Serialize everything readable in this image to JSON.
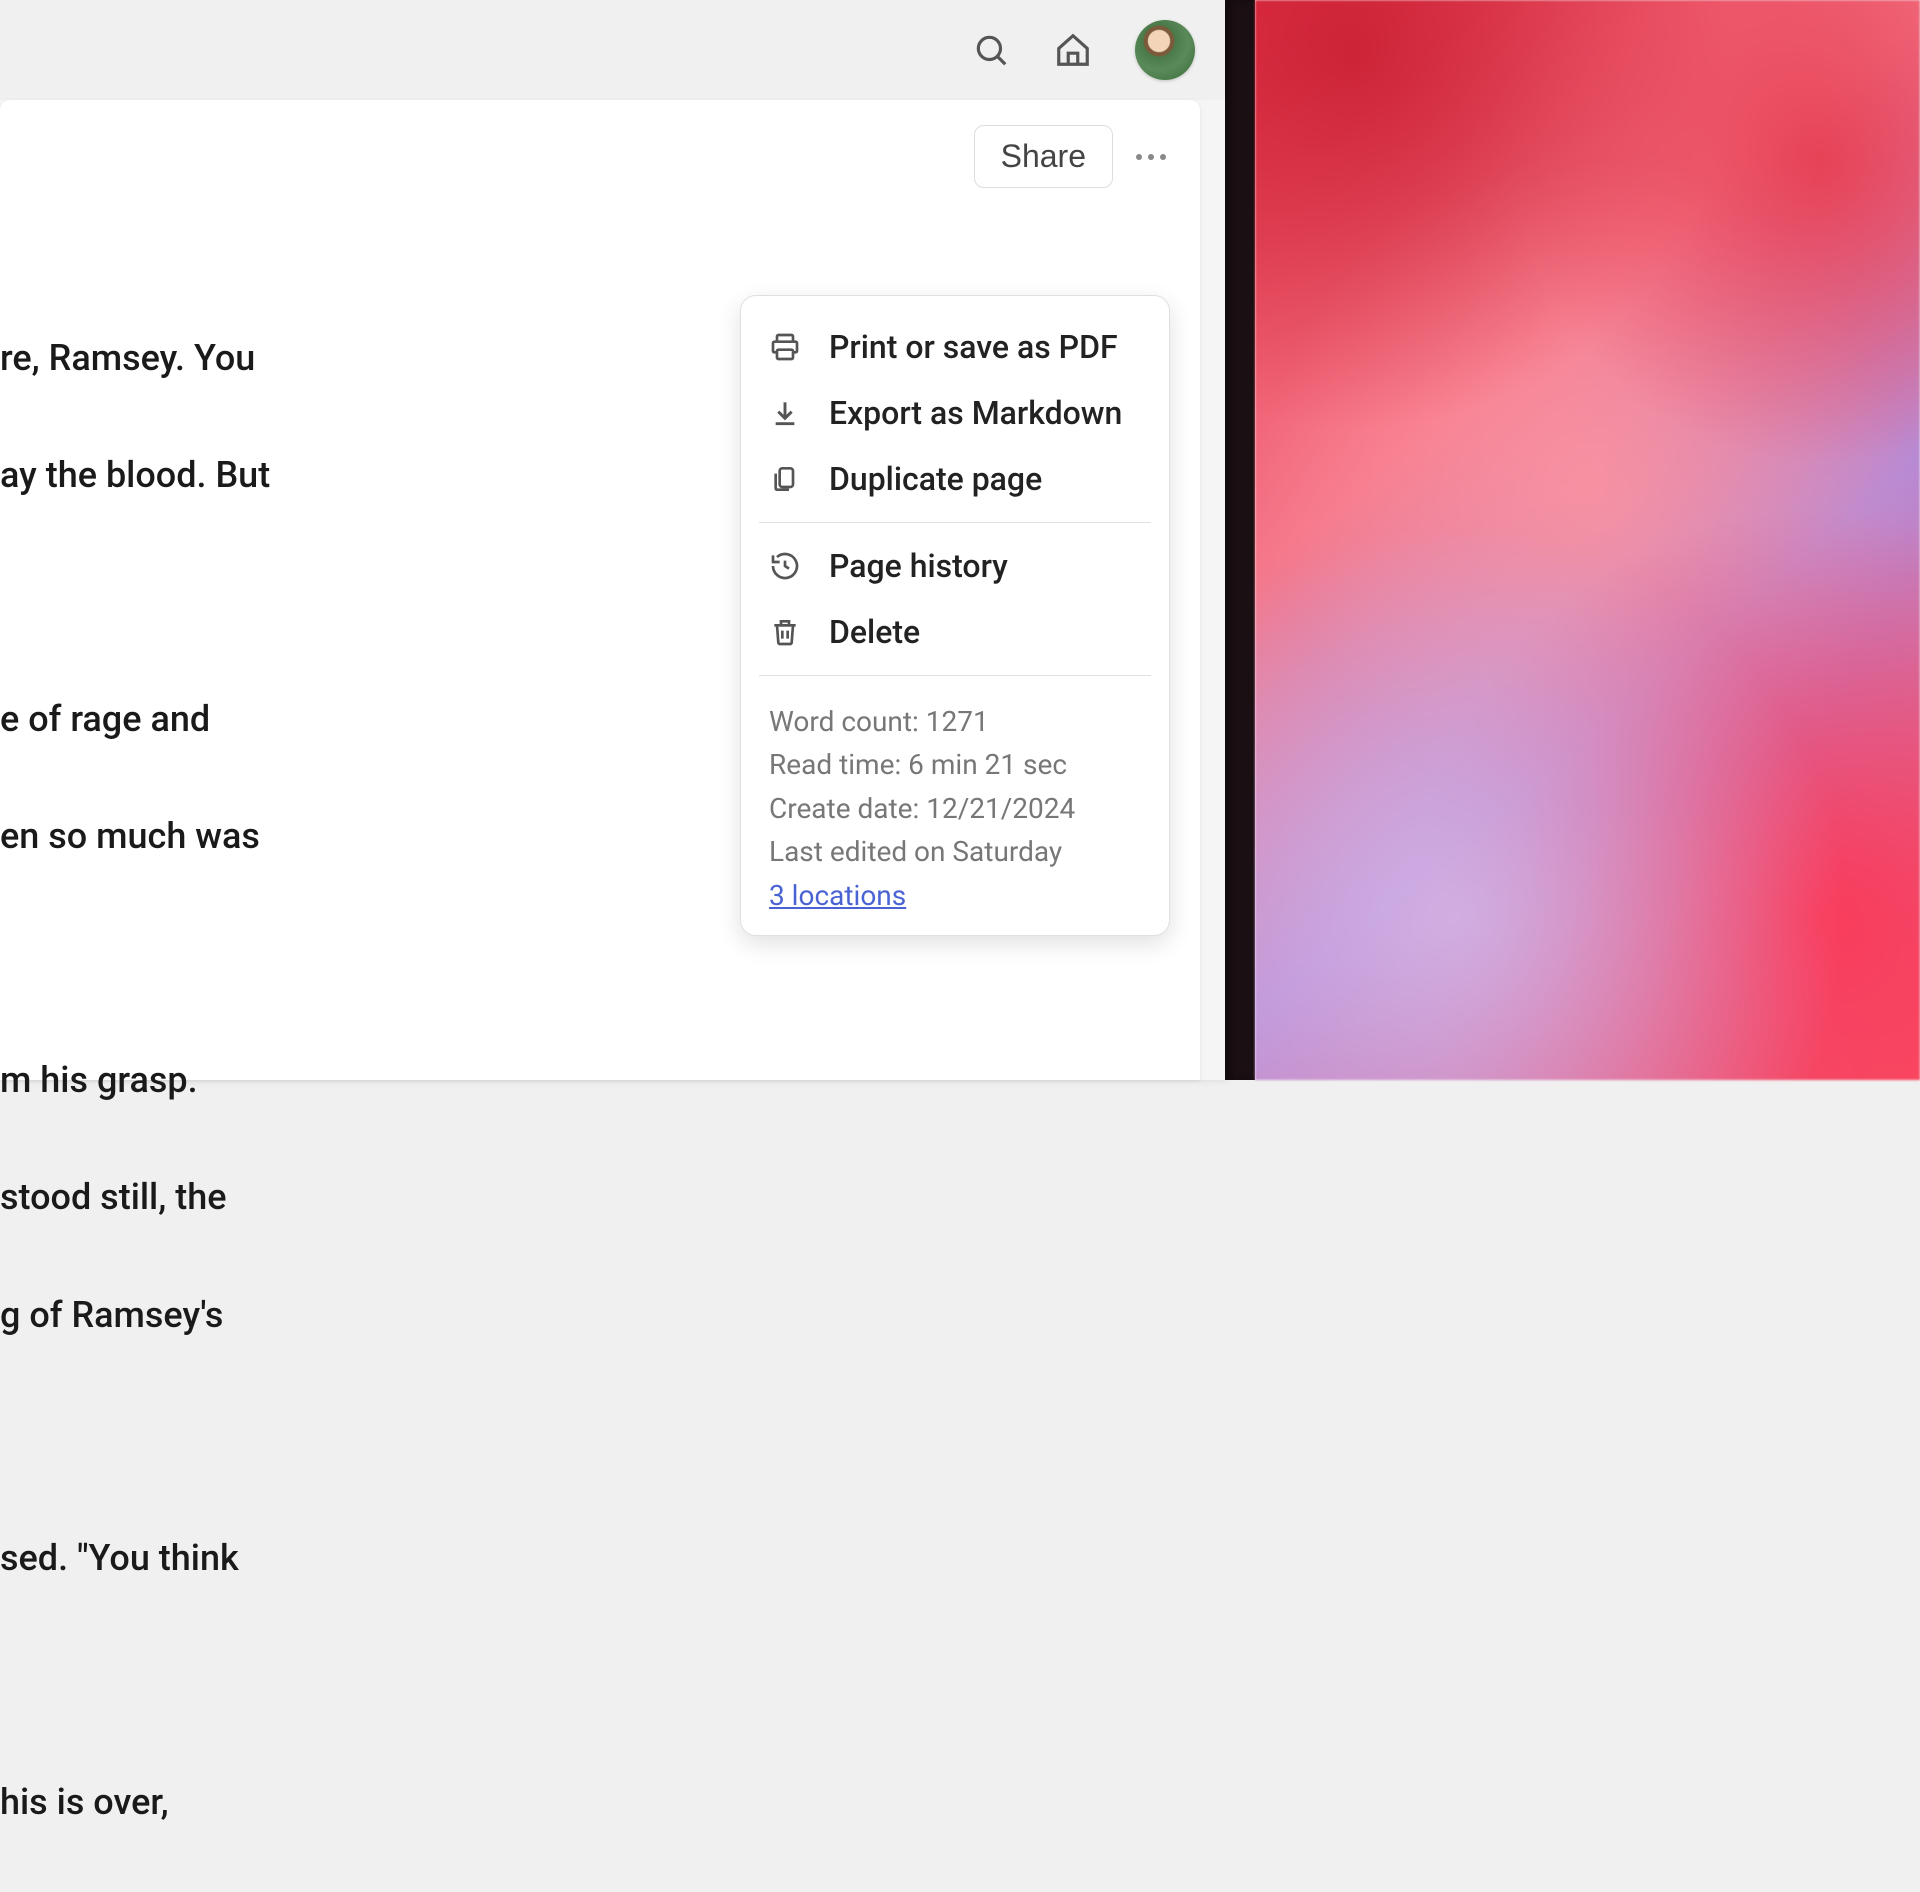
{
  "toolbar": {
    "share_label": "Share"
  },
  "menu": {
    "print_label": "Print or save as PDF",
    "export_label": "Export as Markdown",
    "duplicate_label": "Duplicate page",
    "history_label": "Page history",
    "delete_label": "Delete"
  },
  "info": {
    "word_count_label": "Word count: 1271",
    "read_time_label": "Read time: 6 min 21 sec",
    "create_date_label": "Create date: 12/21/2024",
    "last_edited_label": "Last edited on Saturday",
    "locations_label": "3 locations"
  },
  "document": {
    "line1": "re, Ramsey. You",
    "line2": "ay the blood. But",
    "line3": "e of rage and",
    "line4": "en so much was",
    "line5": "m his grasp.",
    "line6": "stood still, the",
    "line7": "g of Ramsey's",
    "line8": "sed. \"You think",
    "line9": "his is over,"
  }
}
